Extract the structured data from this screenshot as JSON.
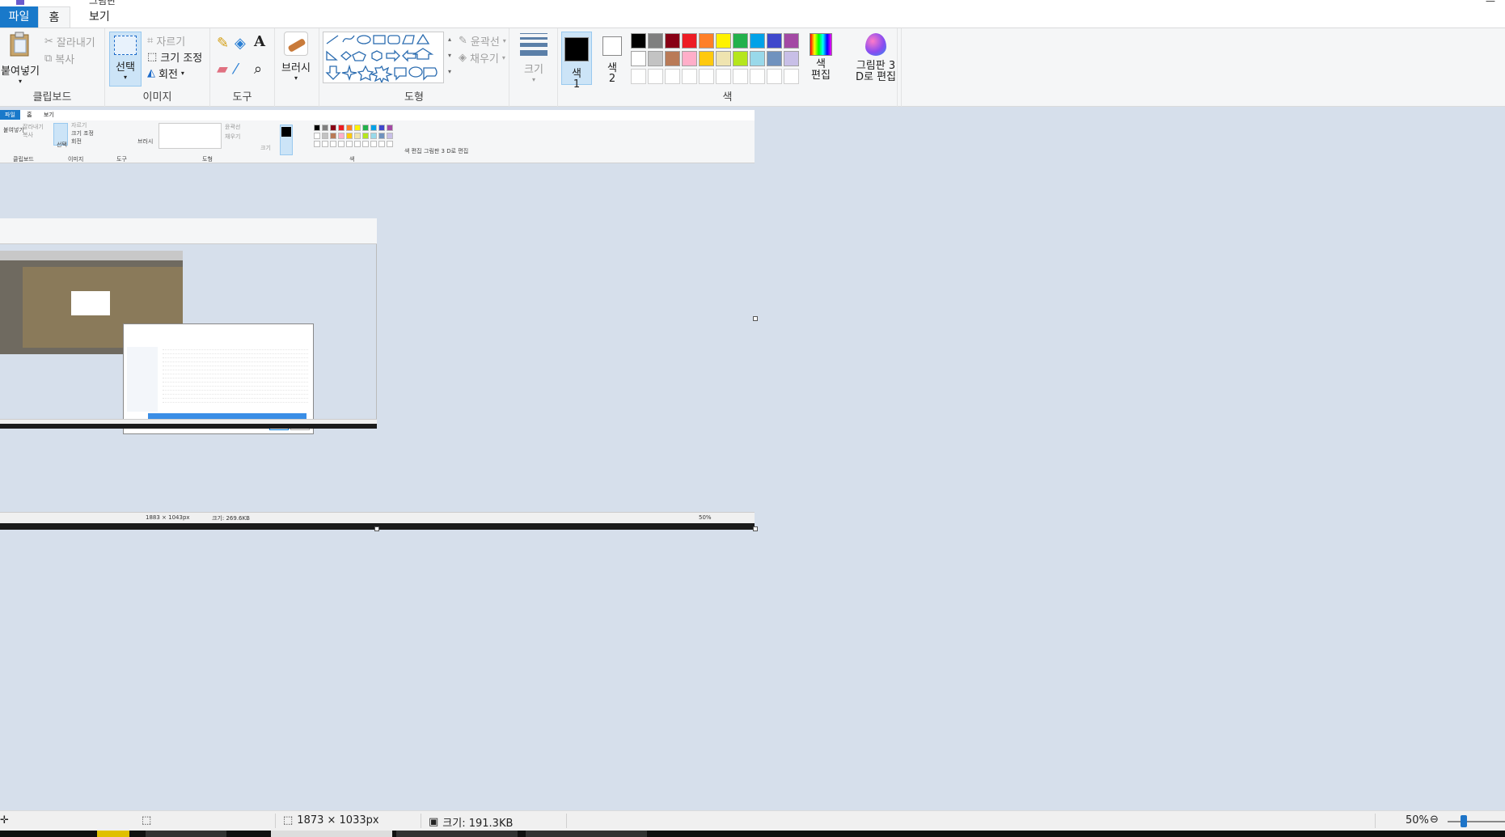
{
  "window": {
    "title": "그림판",
    "menu": {
      "file": "파일",
      "home": "홈",
      "view": "보기"
    }
  },
  "ribbon": {
    "clipboard": {
      "paste": "붙여넣기",
      "cut": "잘라내기",
      "copy": "복사",
      "label": "클립보드"
    },
    "image": {
      "select": "선택",
      "crop": "자르기",
      "resize": "크기 조정",
      "rotate": "회전",
      "label": "이미지"
    },
    "tools": {
      "label": "도구"
    },
    "brushes": {
      "label": "브러시"
    },
    "shapes": {
      "outline": "윤곽선",
      "fill": "채우기",
      "label": "도형"
    },
    "size": {
      "label": "크기"
    },
    "colors": {
      "color1": "색\n1",
      "color1_line1": "색",
      "color1_line2": "1",
      "color2_line1": "색",
      "color2_line2": "2",
      "edit_line1": "색",
      "edit_line2": "편집",
      "label": "색",
      "color1_value": "#000000",
      "color2_value": "#ffffff",
      "palette_row1": [
        "#000000",
        "#7f7f7f",
        "#880015",
        "#ed1c24",
        "#ff7f27",
        "#fff200",
        "#22b14c",
        "#00a2e8",
        "#3f48cc",
        "#a349a4"
      ],
      "palette_row2": [
        "#ffffff",
        "#c3c3c3",
        "#b97a57",
        "#ffaec9",
        "#ffc90e",
        "#efe4b0",
        "#b5e61d",
        "#99d9ea",
        "#7092be",
        "#c8bfe7"
      ],
      "palette_row3": [
        "#ffffff",
        "#ffffff",
        "#ffffff",
        "#ffffff",
        "#ffffff",
        "#ffffff",
        "#ffffff",
        "#ffffff",
        "#ffffff",
        "#ffffff"
      ]
    },
    "paint3d": {
      "line1": "그림판 3",
      "line2": "D로 편집"
    }
  },
  "nested": {
    "menu": {
      "file": "파일",
      "home": "홈",
      "view": "보기"
    },
    "labels": {
      "clipboard": "클립보드",
      "image": "이미지",
      "tools": "도구",
      "shapes": "도형",
      "colors": "색",
      "select": "선택",
      "brush": "브러시",
      "size": "크기",
      "edit": "색\n편집",
      "paint3d": "그림판 3\nD로 편집",
      "cut": "잘라내기",
      "copy": "복사",
      "paste": "붙여넣기",
      "crop": "자르기",
      "resize": "크기 조정",
      "rotate": "회전",
      "outline": "윤곽선",
      "fill": "채우기"
    },
    "status": {
      "dimensions": "1883 × 1043px",
      "size": "크기: 269.6KB",
      "zoom": "50%"
    }
  },
  "status": {
    "dimensions": "1873 × 1033px",
    "size": "크기: 191.3KB",
    "zoom": "50%",
    "zoom_level": 0.5
  }
}
